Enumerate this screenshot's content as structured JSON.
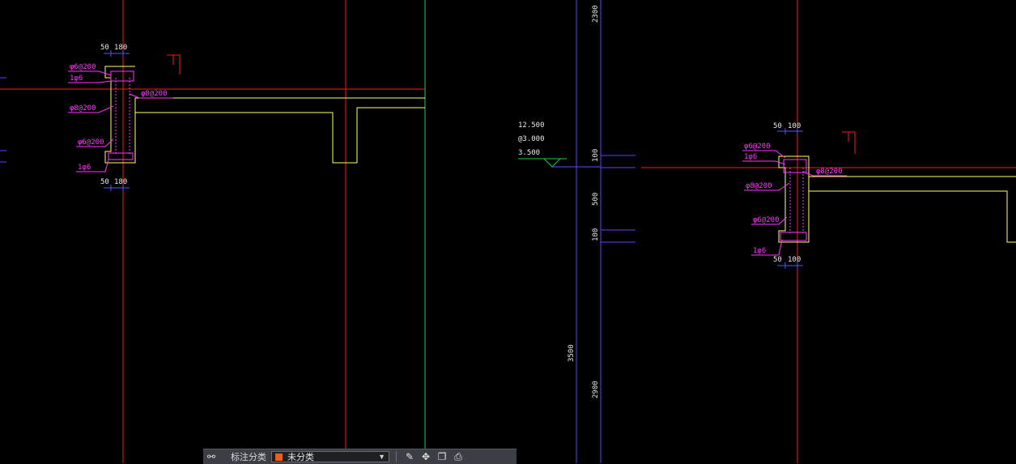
{
  "colors": {
    "axis_red": "#ff1a1a",
    "outline_yellow": "#ffff66",
    "dim_magenta": "#ff33ff",
    "guide_purple": "#6a3cff",
    "dim_blue": "#5555ff",
    "green": "#22cc44",
    "text_white": "#e8e8e8",
    "toolbar_bg": "#3b3f45",
    "swatch_orange": "#e8601c"
  },
  "left_detail": {
    "dim_top": [
      "50",
      "180"
    ],
    "dim_bottom": [
      "50",
      "180"
    ],
    "rebar_labels": [
      "φ6@200",
      "1φ6",
      "φ8@200",
      "φ8@200",
      "φ6@200",
      "1φ6"
    ]
  },
  "right_detail": {
    "dim_top": [
      "50",
      "100"
    ],
    "dim_bottom": [
      "50",
      "100"
    ],
    "rebar_labels": [
      "φ6@200",
      "1φ6",
      "φ8@200",
      "φ8@200",
      "φ6@200",
      "1φ6"
    ]
  },
  "elevation": {
    "lines": [
      "12.500",
      "@3.000",
      "3.500"
    ]
  },
  "vertical_dims": {
    "top": "2300",
    "d100a": "100",
    "d500": "500",
    "d100b": "100",
    "d3500": "3500",
    "d2900": "2900"
  },
  "toolbar": {
    "group_icon": "group-icon",
    "category_label": "标注分类",
    "select_value": "未分类",
    "tools": [
      "edit-icon",
      "move-icon",
      "copy-icon",
      "print-icon"
    ]
  }
}
